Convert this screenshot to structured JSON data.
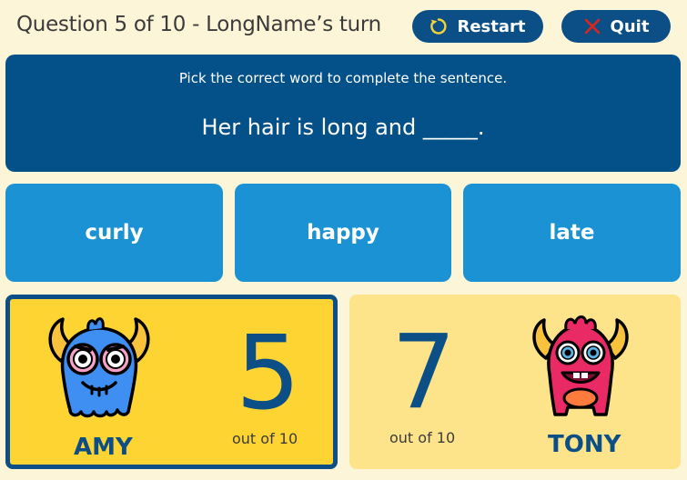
{
  "header": {
    "title": "Question 5 of 10 - LongName’s turn",
    "restart_label": "Restart",
    "quit_label": "Quit",
    "restart_icon": "refresh-icon",
    "quit_icon": "close-x-icon"
  },
  "prompt": {
    "instruction": "Pick the correct word to complete the sentence.",
    "sentence": "Her hair is long and _____."
  },
  "answers": [
    {
      "label": "curly"
    },
    {
      "label": "happy"
    },
    {
      "label": "late"
    }
  ],
  "players": [
    {
      "name": "AMY",
      "score": "5",
      "out_of": "out of 10",
      "active": true,
      "monster": "blue-monster"
    },
    {
      "name": "TONY",
      "score": "7",
      "out_of": "out of 10",
      "active": false,
      "monster": "pink-monster"
    }
  ],
  "colors": {
    "background": "#fdf5d8",
    "primary": "#0b4f86",
    "prompt_bg": "#04518a",
    "answer_bg": "#1a92d3",
    "active_player_bg": "#fed432",
    "inactive_player_bg": "#fde48a",
    "quit_icon": "#e2231a",
    "restart_icon": "#f3d33a"
  }
}
